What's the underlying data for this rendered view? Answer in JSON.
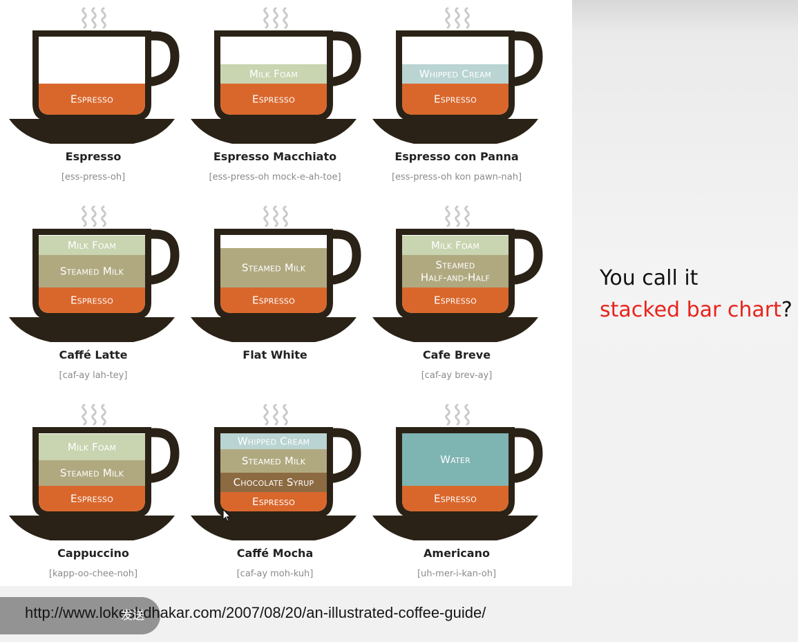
{
  "caption": {
    "line1": "You call it",
    "accent": "stacked bar chart",
    "suffix": "?"
  },
  "url": "http://www.lokeshdhakar.com/2007/08/20/an-illustrated-coffee-guide/",
  "send_label": "发送",
  "colors": {
    "espresso": "#d9672c",
    "milk_foam": "#c9d4b0",
    "steamed_milk": "#b0a980",
    "whipped_cream": "#b9d4d2",
    "chocolate_syrup": "#8c6a42",
    "water": "#7eb4b2",
    "cup": "#2a2216",
    "accent": "#e8231c"
  },
  "drinks": [
    {
      "name": "Espresso",
      "pron": "[ess-press-oh]",
      "layers": [
        {
          "label": "Espresso",
          "kind": "espresso",
          "share": 0.4
        }
      ]
    },
    {
      "name": "Espresso Macchiato",
      "pron": "[ess-press-oh mock-e-ah-toe]",
      "layers": [
        {
          "label": "Espresso",
          "kind": "espresso",
          "share": 0.4
        },
        {
          "label": "Milk Foam",
          "kind": "milk_foam",
          "share": 0.25
        }
      ]
    },
    {
      "name": "Espresso con Panna",
      "pron": "[ess-press-oh kon pawn-nah]",
      "layers": [
        {
          "label": "Espresso",
          "kind": "espresso",
          "share": 0.4
        },
        {
          "label": "Whipped Cream",
          "kind": "whipped_cream",
          "share": 0.25
        }
      ]
    },
    {
      "name": "Caffé Latte",
      "pron": "[caf-ay lah-tey]",
      "layers": [
        {
          "label": "Espresso",
          "kind": "espresso",
          "share": 0.33
        },
        {
          "label": "Steamed Milk",
          "kind": "steamed_milk",
          "share": 0.42
        },
        {
          "label": "Milk Foam",
          "kind": "milk_foam",
          "share": 0.25
        }
      ]
    },
    {
      "name": "Flat White",
      "pron": "",
      "layers": [
        {
          "label": "Espresso",
          "kind": "espresso",
          "share": 0.33
        },
        {
          "label": "Steamed Milk",
          "kind": "steamed_milk",
          "share": 0.5
        }
      ]
    },
    {
      "name": "Cafe Breve",
      "pron": "[caf-ay brev-ay]",
      "layers": [
        {
          "label": "Espresso",
          "kind": "espresso",
          "share": 0.33
        },
        {
          "label": "Steamed Half-and-Half",
          "kind": "steamed_milk",
          "share": 0.42
        },
        {
          "label": "Milk Foam",
          "kind": "milk_foam",
          "share": 0.25
        }
      ]
    },
    {
      "name": "Cappuccino",
      "pron": "[kapp-oo-chee-noh]",
      "layers": [
        {
          "label": "Espresso",
          "kind": "espresso",
          "share": 0.33
        },
        {
          "label": "Steamed Milk",
          "kind": "steamed_milk",
          "share": 0.33
        },
        {
          "label": "Milk Foam",
          "kind": "milk_foam",
          "share": 0.34
        }
      ]
    },
    {
      "name": "Caffé Mocha",
      "pron": "[caf-ay moh-kuh]",
      "layers": [
        {
          "label": "Espresso",
          "kind": "espresso",
          "share": 0.25
        },
        {
          "label": "Chocolate Syrup",
          "kind": "chocolate_syrup",
          "share": 0.25
        },
        {
          "label": "Steamed Milk",
          "kind": "steamed_milk",
          "share": 0.3
        },
        {
          "label": "Whipped Cream",
          "kind": "whipped_cream",
          "share": 0.2
        }
      ]
    },
    {
      "name": "Americano",
      "pron": "[uh-mer-i-kan-oh]",
      "layers": [
        {
          "label": "Espresso",
          "kind": "espresso",
          "share": 0.33
        },
        {
          "label": "Water",
          "kind": "water",
          "share": 0.67
        }
      ]
    }
  ]
}
